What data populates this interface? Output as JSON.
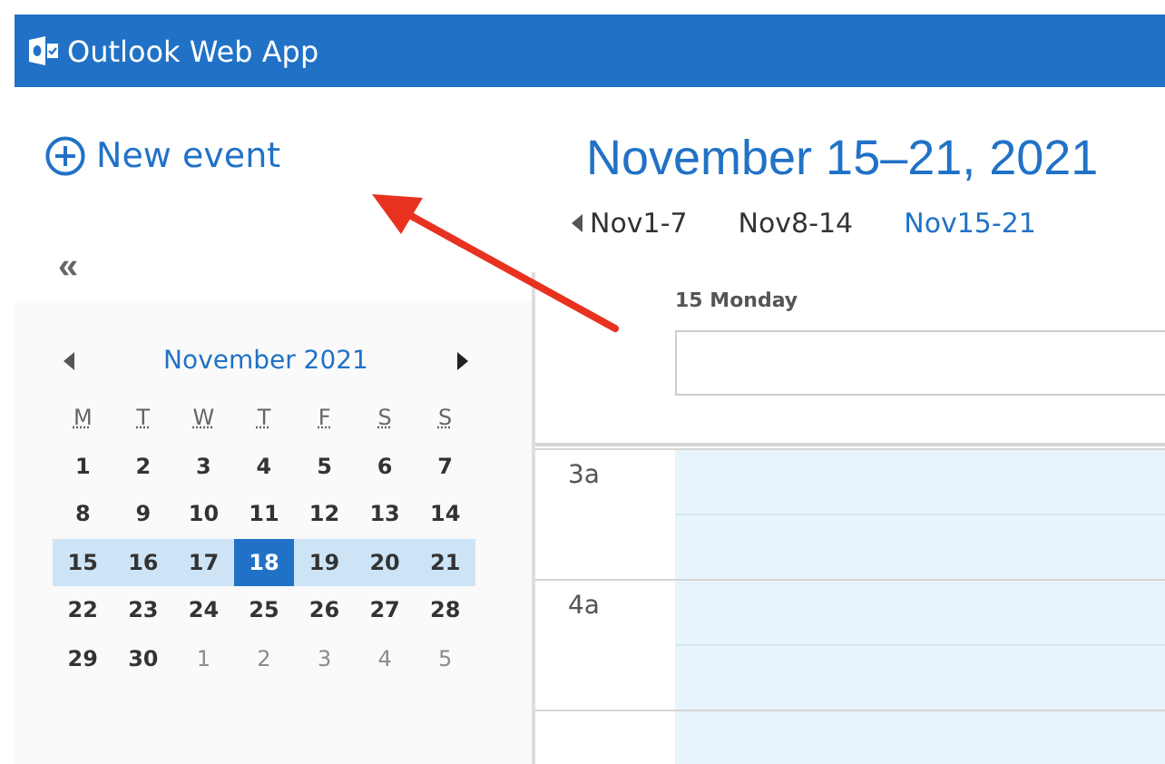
{
  "app": {
    "title": "Outlook Web App"
  },
  "new_event": {
    "label": "New event"
  },
  "collapse": {
    "label": "«"
  },
  "mini_calendar": {
    "month": "November 2021",
    "weekdays": [
      "M",
      "T",
      "W",
      "T",
      "F",
      "S",
      "S"
    ],
    "weeks": [
      {
        "selected": false,
        "days": [
          {
            "label": "1",
            "in_month": true,
            "selected": false
          },
          {
            "label": "2",
            "in_month": true,
            "selected": false
          },
          {
            "label": "3",
            "in_month": true,
            "selected": false
          },
          {
            "label": "4",
            "in_month": true,
            "selected": false
          },
          {
            "label": "5",
            "in_month": true,
            "selected": false
          },
          {
            "label": "6",
            "in_month": true,
            "selected": false
          },
          {
            "label": "7",
            "in_month": true,
            "selected": false
          }
        ]
      },
      {
        "selected": false,
        "days": [
          {
            "label": "8",
            "in_month": true,
            "selected": false
          },
          {
            "label": "9",
            "in_month": true,
            "selected": false
          },
          {
            "label": "10",
            "in_month": true,
            "selected": false
          },
          {
            "label": "11",
            "in_month": true,
            "selected": false
          },
          {
            "label": "12",
            "in_month": true,
            "selected": false
          },
          {
            "label": "13",
            "in_month": true,
            "selected": false
          },
          {
            "label": "14",
            "in_month": true,
            "selected": false
          }
        ]
      },
      {
        "selected": true,
        "days": [
          {
            "label": "15",
            "in_month": true,
            "selected": false
          },
          {
            "label": "16",
            "in_month": true,
            "selected": false
          },
          {
            "label": "17",
            "in_month": true,
            "selected": false
          },
          {
            "label": "18",
            "in_month": true,
            "selected": true
          },
          {
            "label": "19",
            "in_month": true,
            "selected": false
          },
          {
            "label": "20",
            "in_month": true,
            "selected": false
          },
          {
            "label": "21",
            "in_month": true,
            "selected": false
          }
        ]
      },
      {
        "selected": false,
        "days": [
          {
            "label": "22",
            "in_month": true,
            "selected": false
          },
          {
            "label": "23",
            "in_month": true,
            "selected": false
          },
          {
            "label": "24",
            "in_month": true,
            "selected": false
          },
          {
            "label": "25",
            "in_month": true,
            "selected": false
          },
          {
            "label": "26",
            "in_month": true,
            "selected": false
          },
          {
            "label": "27",
            "in_month": true,
            "selected": false
          },
          {
            "label": "28",
            "in_month": true,
            "selected": false
          }
        ]
      },
      {
        "selected": false,
        "days": [
          {
            "label": "29",
            "in_month": true,
            "selected": false
          },
          {
            "label": "30",
            "in_month": true,
            "selected": false
          },
          {
            "label": "1",
            "in_month": false,
            "selected": false
          },
          {
            "label": "2",
            "in_month": false,
            "selected": false
          },
          {
            "label": "3",
            "in_month": false,
            "selected": false
          },
          {
            "label": "4",
            "in_month": false,
            "selected": false
          },
          {
            "label": "5",
            "in_month": false,
            "selected": false
          }
        ]
      }
    ]
  },
  "range_title": "November 15–21, 2021",
  "week_nav": [
    {
      "label": "Nov1-7",
      "selected": false
    },
    {
      "label": "Nov8-14",
      "selected": false
    },
    {
      "label": "Nov15-21",
      "selected": true
    }
  ],
  "day_column": {
    "heading": "15 Monday"
  },
  "hours": [
    "3a",
    "4a"
  ]
}
